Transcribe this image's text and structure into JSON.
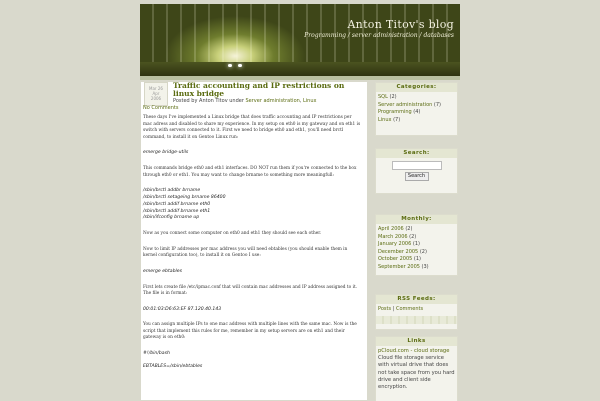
{
  "header": {
    "title": "Anton Titov's blog",
    "subtitle": "Programming / server administration / databases"
  },
  "post": {
    "date_badge": [
      "Mar 26",
      "Apr",
      "2006"
    ],
    "title": "Traffic accounting and IP restrictions on linux bridge",
    "meta_prefix": "Posted by Anton Titov under",
    "meta_cat1": "Server administration",
    "meta_sep": ",",
    "meta_cat2": "Linux",
    "comments": "No Comments",
    "p1": "These days I've implemented a Linux bridge that does traffic accounting and IP restrictions per mac adress and disabled to share my experience. In my setup on eth0 is my gateway and on eth1 is switch with servers connected to it. First we need to bridge eth0 and eth1, you'll need brctl command, to install it on Gentoo Linux run:",
    "code1": "emerge bridge-utils",
    "p2": "This commands bridge eth0 and eth1 interfaces. DO NOT run them if you're connected to the box through eth0 or eth1. You may want to change brname to something more meaningfull:",
    "code2": [
      "/sbin/brctl addbr brname",
      "/sbin/brctl setageing brname 86400",
      "/sbin/brctl addif brname eth0",
      "/sbin/brctl addif brname eth1",
      "/sbin/ifconfig brname up"
    ],
    "p3": "Now as you connect some computer on eth0 and eth1 they should see each other.",
    "p4": "Now to limit IP addresses per mac address you will need ebtables (you should enable them in kernel configuration too), to install it on Gentoo I use:",
    "code3": "emerge ebtables",
    "p5": "First lets create file /etc/ipmac.conf that will contain mac addresses and IP address assigned to it. The file is in format:",
    "code4": "00:01:03:D6:63:EF 87.120.40.143",
    "p6": "You can assign multiple IPs to one mac address with multiple lines with the same mac. Now is the script that implement this rules for me, remember in my setup servers are on eth1 and their gateway is on eth0:",
    "code5": [
      "#!/bin/bash",
      "EBTABLES=/sbin/ebtables"
    ]
  },
  "sidebar": {
    "categories": {
      "title": "Categories:",
      "items": [
        {
          "name": "SQL",
          "count": "(2)"
        },
        {
          "name": "Server administration",
          "count": "(7)"
        },
        {
          "name": "Programming",
          "count": "(4)"
        },
        {
          "name": "Linux",
          "count": "(7)"
        }
      ]
    },
    "search": {
      "title": "Search:",
      "button": "Search"
    },
    "monthly": {
      "title": "Monthly:",
      "items": [
        {
          "name": "April 2006",
          "count": "(2)"
        },
        {
          "name": "March 2006",
          "count": "(2)"
        },
        {
          "name": "January 2006",
          "count": "(1)"
        },
        {
          "name": "December 2005",
          "count": "(2)"
        },
        {
          "name": "October 2005",
          "count": "(1)"
        },
        {
          "name": "September 2005",
          "count": "(3)"
        }
      ]
    },
    "rss": {
      "title": "RSS Feeds:",
      "posts": "Posts",
      "sep": "|",
      "comments": "Comments"
    },
    "links": {
      "title": "Links",
      "link": "pCloud.com - cloud storage",
      "text": "Cloud file storage service with virtual drive that does not take space from you hard drive and client side encryption."
    }
  }
}
